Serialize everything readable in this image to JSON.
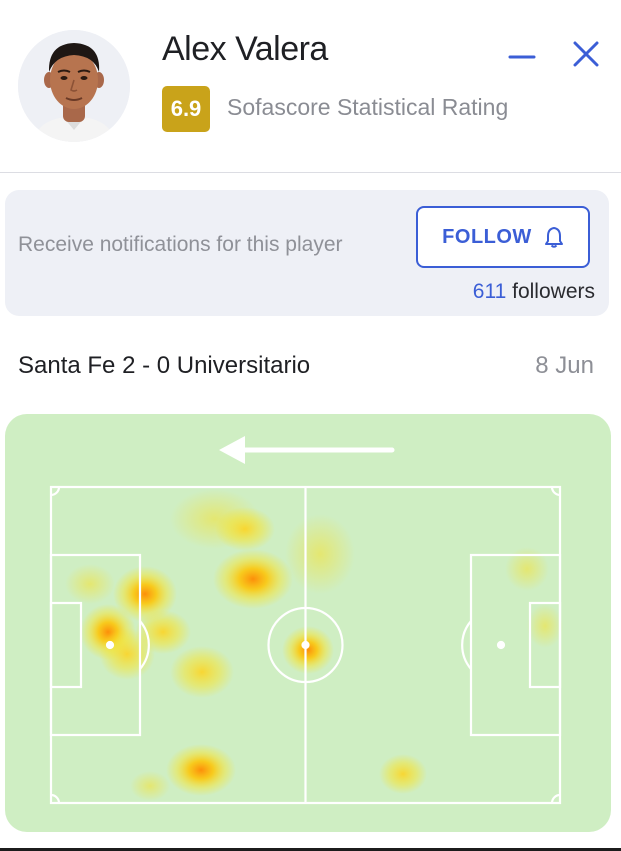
{
  "player": {
    "name": "Alex Valera",
    "rating": "6.9",
    "rating_label": "Sofascore Statistical Rating",
    "rating_color": "#c9a31a"
  },
  "window_controls": {
    "minimize_icon": "minus-icon",
    "close_icon": "close-icon",
    "color": "#3b5ed6"
  },
  "notifications": {
    "text": "Receive notifications for this player",
    "follow_label": "FOLLOW",
    "follow_icon": "bell-icon",
    "followers_count": "611",
    "followers_label": "followers"
  },
  "match": {
    "title": "Santa Fe 2 - 0 Universitario",
    "date": "8 Jun"
  },
  "heatmap": {
    "attack_direction": "left",
    "pitch_color": "#cfeec3",
    "hot_color": "#ff8a00",
    "warm_color": "#f7e32b"
  }
}
